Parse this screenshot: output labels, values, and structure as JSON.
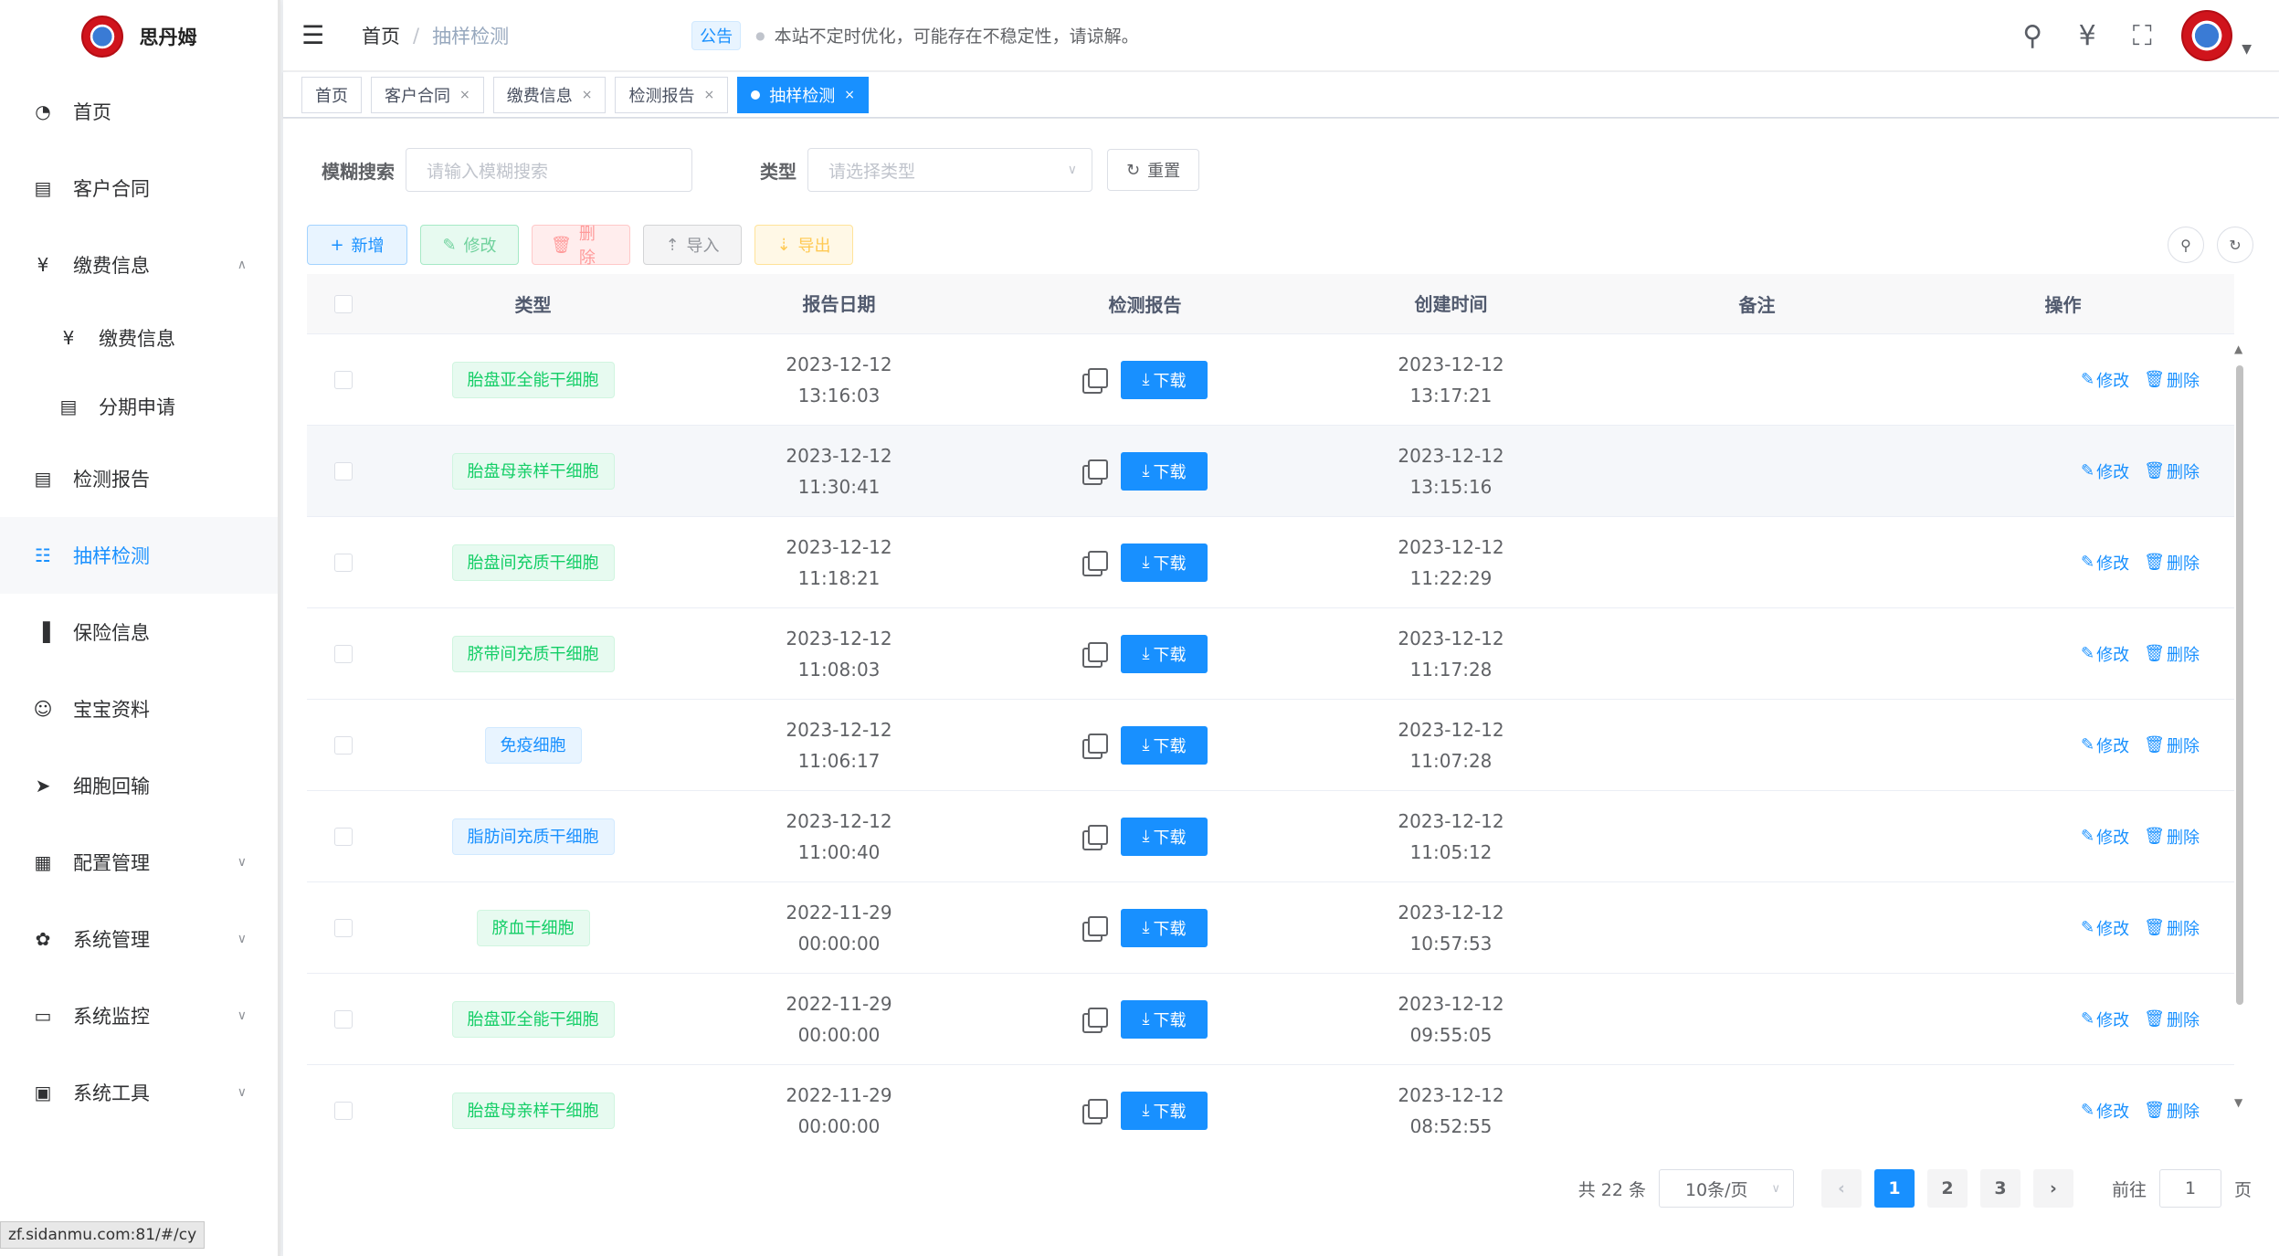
{
  "app": {
    "name": "思丹姆"
  },
  "sidebar": {
    "items": [
      {
        "label": "首页",
        "icon": "dashboard-icon"
      },
      {
        "label": "客户合同",
        "icon": "document-icon"
      },
      {
        "label": "缴费信息",
        "icon": "yen-icon",
        "expanded": true
      },
      {
        "label": "缴费信息",
        "icon": "yen-icon",
        "sub": true
      },
      {
        "label": "分期申请",
        "icon": "document-icon",
        "sub": true
      },
      {
        "label": "检测报告",
        "icon": "document-icon"
      },
      {
        "label": "抽样检测",
        "icon": "list-icon",
        "active": true
      },
      {
        "label": "保险信息",
        "icon": "info-icon"
      },
      {
        "label": "宝宝资料",
        "icon": "baby-icon"
      },
      {
        "label": "细胞回输",
        "icon": "send-icon"
      },
      {
        "label": "配置管理",
        "icon": "config-icon",
        "collapsible": true
      },
      {
        "label": "系统管理",
        "icon": "gear-icon",
        "collapsible": true
      },
      {
        "label": "系统监控",
        "icon": "monitor-icon",
        "collapsible": true
      },
      {
        "label": "系统工具",
        "icon": "toolbox-icon",
        "collapsible": true
      }
    ],
    "url_hint": "zf.sidanmu.com:81/#/cy"
  },
  "header": {
    "breadcrumb": [
      "首页",
      "抽样检测"
    ],
    "breadcrumb_sep": "/",
    "notice_badge": "公告",
    "notice_text": "本站不定时优化，可能存在不稳定性，请谅解。"
  },
  "tags": [
    {
      "label": "首页",
      "closable": false
    },
    {
      "label": "客户合同",
      "closable": true
    },
    {
      "label": "缴费信息",
      "closable": true
    },
    {
      "label": "检测报告",
      "closable": true
    },
    {
      "label": "抽样检测",
      "closable": true,
      "active": true
    }
  ],
  "search": {
    "fuzzy_label": "模糊搜索",
    "fuzzy_placeholder": "请输入模糊搜索",
    "type_label": "类型",
    "type_placeholder": "请选择类型",
    "reset_label": "重置"
  },
  "toolbar": {
    "add": "新增",
    "edit": "修改",
    "delete": "删除",
    "import": "导入",
    "export": "导出"
  },
  "table": {
    "columns": [
      "类型",
      "报告日期",
      "检测报告",
      "创建时间",
      "备注",
      "操作"
    ],
    "download_label": "下载",
    "edit_label": "修改",
    "delete_label": "删除",
    "rows": [
      {
        "type": "胎盘亚全能干细胞",
        "tag": "success",
        "report_date": "2023-12-12",
        "report_time": "13:16:03",
        "created_date": "2023-12-12",
        "created_time": "13:17:21",
        "remark": ""
      },
      {
        "type": "胎盘母亲样干细胞",
        "tag": "success",
        "report_date": "2023-12-12",
        "report_time": "11:30:41",
        "created_date": "2023-12-12",
        "created_time": "13:15:16",
        "remark": ""
      },
      {
        "type": "胎盘间充质干细胞",
        "tag": "success",
        "report_date": "2023-12-12",
        "report_time": "11:18:21",
        "created_date": "2023-12-12",
        "created_time": "11:22:29",
        "remark": ""
      },
      {
        "type": "脐带间充质干细胞",
        "tag": "success",
        "report_date": "2023-12-12",
        "report_time": "11:08:03",
        "created_date": "2023-12-12",
        "created_time": "11:17:28",
        "remark": ""
      },
      {
        "type": "免疫细胞",
        "tag": "primary",
        "report_date": "2023-12-12",
        "report_time": "11:06:17",
        "created_date": "2023-12-12",
        "created_time": "11:07:28",
        "remark": ""
      },
      {
        "type": "脂肪间充质干细胞",
        "tag": "primary",
        "report_date": "2023-12-12",
        "report_time": "11:00:40",
        "created_date": "2023-12-12",
        "created_time": "11:05:12",
        "remark": ""
      },
      {
        "type": "脐血干细胞",
        "tag": "success",
        "report_date": "2022-11-29",
        "report_time": "00:00:00",
        "created_date": "2023-12-12",
        "created_time": "10:57:53",
        "remark": ""
      },
      {
        "type": "胎盘亚全能干细胞",
        "tag": "success",
        "report_date": "2022-11-29",
        "report_time": "00:00:00",
        "created_date": "2023-12-12",
        "created_time": "09:55:05",
        "remark": ""
      },
      {
        "type": "胎盘母亲样干细胞",
        "tag": "success",
        "report_date": "2022-11-29",
        "report_time": "00:00:00",
        "created_date": "2023-12-12",
        "created_time": "08:52:55",
        "remark": ""
      }
    ]
  },
  "pagination": {
    "total_text": "共 22 条",
    "page_size": "10条/页",
    "pages": [
      "1",
      "2",
      "3"
    ],
    "current": "1",
    "goto_label": "前往",
    "goto_value": "1",
    "page_suffix": "页"
  },
  "colors": {
    "primary": "#1890ff",
    "success": "#13ce66",
    "danger": "#ff4949",
    "warning": "#ffba00"
  }
}
